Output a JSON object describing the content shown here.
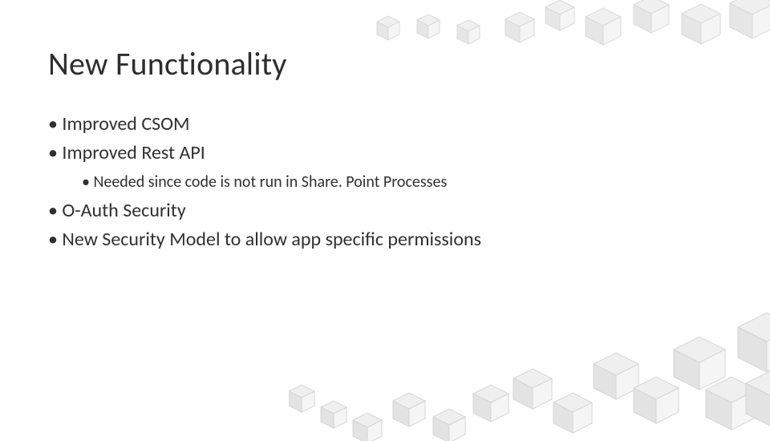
{
  "title": "New Functionality",
  "bullets": {
    "b1": "Improved CSOM",
    "b2": "Improved Rest API",
    "b2_sub1": "Needed since code is not run in Share. Point Processes",
    "b3": "O-Auth Security",
    "b4": "New Security Model to allow app specific permissions"
  }
}
